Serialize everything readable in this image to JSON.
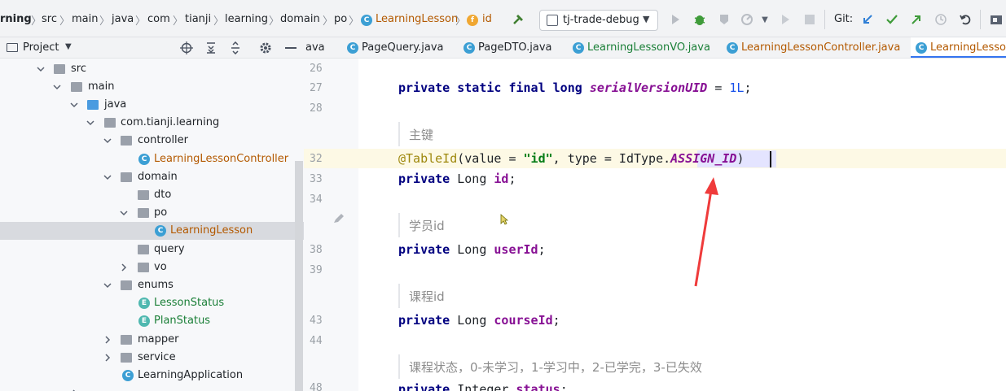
{
  "navbar": {
    "breadcrumbs": [
      "rning",
      "src",
      "main",
      "java",
      "com",
      "tianji",
      "learning",
      "domain",
      "po",
      "LearningLesson",
      "id"
    ],
    "run_config": "tj-trade-debug",
    "git_label": "Git:"
  },
  "project_panel": {
    "title": "Project"
  },
  "tabs": [
    {
      "label": "ava",
      "color": "#1f2328"
    },
    {
      "label": "PageQuery.java",
      "color": "#1f2328"
    },
    {
      "label": "PageDTO.java",
      "color": "#1f2328"
    },
    {
      "label": "LearningLessonVO.java",
      "color": "#1a7f37"
    },
    {
      "label": "LearningLessonController.java",
      "color": "#b35900"
    },
    {
      "label": "LearningLesson",
      "color": "#b35900"
    }
  ],
  "tree": [
    {
      "label": "src",
      "type": "folder",
      "expanded": true,
      "color": "#1f2328"
    },
    {
      "label": "main",
      "type": "folder",
      "expanded": true,
      "color": "#1f2328"
    },
    {
      "label": "java",
      "type": "folder-blue",
      "expanded": true,
      "color": "#1f2328"
    },
    {
      "label": "com.tianji.learning",
      "type": "package",
      "expanded": true,
      "color": "#1f2328"
    },
    {
      "label": "controller",
      "type": "package",
      "expanded": true,
      "color": "#1f2328"
    },
    {
      "label": "LearningLessonController",
      "type": "class",
      "color": "#b35900"
    },
    {
      "label": "domain",
      "type": "package",
      "expanded": true,
      "color": "#1f2328"
    },
    {
      "label": "dto",
      "type": "package",
      "color": "#1f2328"
    },
    {
      "label": "po",
      "type": "package",
      "expanded": true,
      "color": "#1f2328"
    },
    {
      "label": "LearningLesson",
      "type": "class",
      "color": "#b35900",
      "selected": true
    },
    {
      "label": "query",
      "type": "package",
      "color": "#1f2328"
    },
    {
      "label": "vo",
      "type": "package",
      "expanded": false,
      "color": "#1f2328"
    },
    {
      "label": "enums",
      "type": "package",
      "expanded": true,
      "color": "#1f2328"
    },
    {
      "label": "LessonStatus",
      "type": "enum",
      "color": "#1a7f37"
    },
    {
      "label": "PlanStatus",
      "type": "enum",
      "color": "#1a7f37"
    },
    {
      "label": "mapper",
      "type": "package",
      "expanded": false,
      "color": "#1f2328"
    },
    {
      "label": "service",
      "type": "package",
      "expanded": false,
      "color": "#1f2328"
    },
    {
      "label": "LearningApplication",
      "type": "app",
      "color": "#1f2328"
    }
  ],
  "editor": {
    "line_numbers": [
      "26",
      "27",
      "28",
      "32",
      "33",
      "34",
      "38",
      "39",
      "43",
      "44",
      "48"
    ],
    "doc_comments": [
      "主键",
      "学员id",
      "课程id",
      "课程状态，0-未学习，1-学习中，2-已学完，3-已失效"
    ],
    "code": {
      "serial_kw": "private static final long",
      "serial_const": "serialVersionUID",
      "serial_eq": " = ",
      "serial_val": "1L",
      "semi": ";",
      "ann": "@TableId",
      "ann_open": "(value = ",
      "ann_str": "\"id\"",
      "ann_mid": ", type = IdType.",
      "ann_const": "ASSIGN_ID",
      "ann_close": ")",
      "private_kw": "private",
      "long_type": " Long ",
      "integer_type": " Integer ",
      "id_field": "id",
      "user_field": "userId",
      "course_field": "courseId",
      "status_field": "status"
    }
  },
  "accent": {
    "arrow": "#ef3b3b",
    "tab_active_underline": "#3574f0"
  }
}
